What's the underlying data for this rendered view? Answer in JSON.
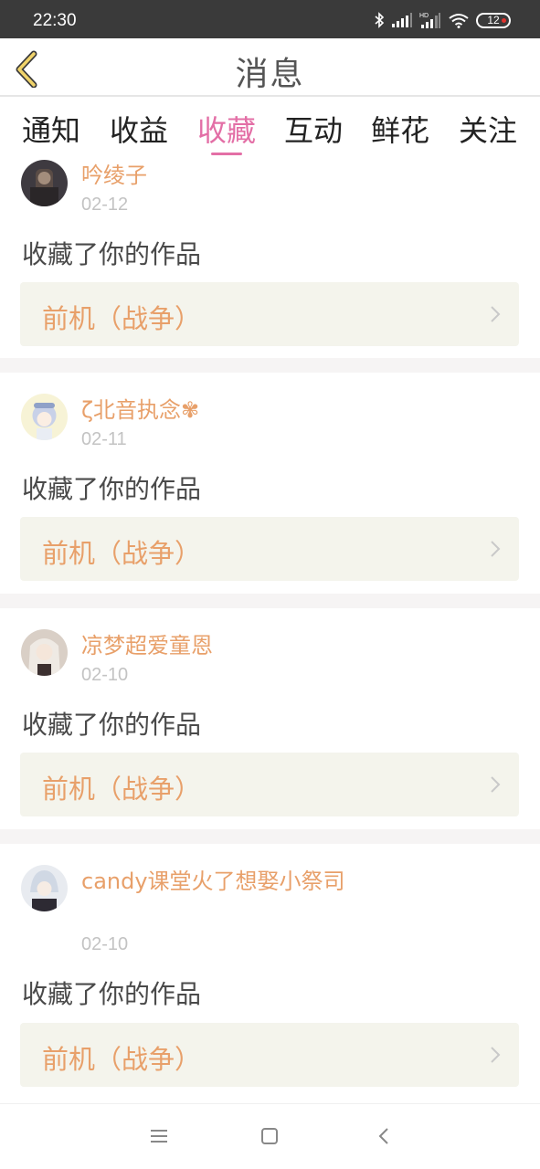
{
  "status_bar": {
    "time": "22:30",
    "battery": "12",
    "icons": [
      "bluetooth-icon",
      "signal-icon",
      "hd-signal-icon",
      "wifi-icon",
      "battery-icon"
    ]
  },
  "header": {
    "title": "消息",
    "back_icon": "chevron-left-icon"
  },
  "tabs": [
    {
      "label": "通知"
    },
    {
      "label": "收益"
    },
    {
      "label": "收藏",
      "active": true
    },
    {
      "label": "互动"
    },
    {
      "label": "鲜花"
    },
    {
      "label": "关注"
    }
  ],
  "colors": {
    "accent": "#e36fa6",
    "username": "#e8a06a",
    "work_bg": "#f4f4ec",
    "status_bar": "#3a3a3a"
  },
  "items": [
    {
      "username": "吟绫子",
      "date": "02-12",
      "message": "收藏了你的作品",
      "work_title": "前机（战争）"
    },
    {
      "username": "ζ北音执念✾",
      "date": "02-11",
      "message": "收藏了你的作品",
      "work_title": "前机（战争）"
    },
    {
      "username": "凉梦超爱童恩",
      "date": "02-10",
      "message": "收藏了你的作品",
      "work_title": "前机（战争）"
    },
    {
      "username": "candy课堂火了想娶小祭司",
      "date": "02-10",
      "message": "收藏了你的作品",
      "work_title": "前机（战争）"
    }
  ],
  "nav_bar": {
    "icons": [
      "menu-icon",
      "home-square-icon",
      "back-chevron-icon"
    ]
  }
}
